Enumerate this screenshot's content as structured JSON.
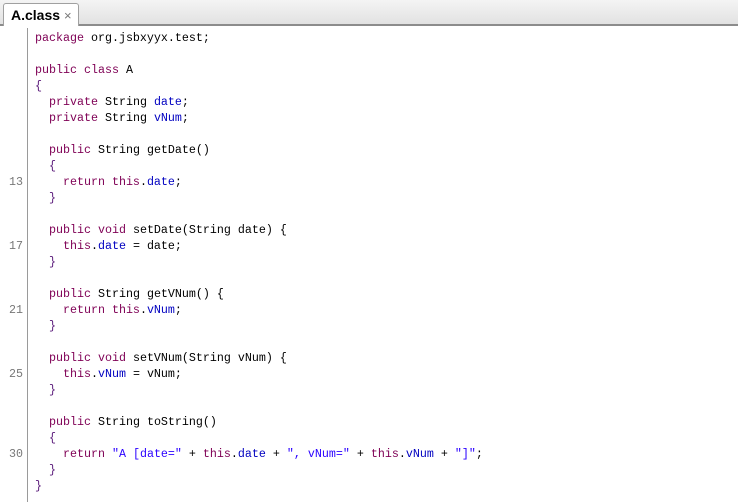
{
  "tab": {
    "title": "A.class",
    "close_icon": "×"
  },
  "colors": {
    "keyword": "#7f0055",
    "field": "#0000c0",
    "string": "#2a00ff"
  },
  "lines": [
    {
      "n": "",
      "t": [
        [
          "kw",
          "package"
        ],
        [
          "txt",
          " org.jsbxyyx.test;"
        ]
      ]
    },
    {
      "n": "",
      "t": []
    },
    {
      "n": "",
      "t": [
        [
          "kw",
          "public class"
        ],
        [
          "txt",
          " A"
        ]
      ]
    },
    {
      "n": "",
      "t": [
        [
          "br",
          "{"
        ]
      ]
    },
    {
      "n": "",
      "t": [
        [
          "txt",
          "  "
        ],
        [
          "kw",
          "private"
        ],
        [
          "txt",
          " String "
        ],
        [
          "fld",
          "date"
        ],
        [
          "txt",
          ";"
        ]
      ]
    },
    {
      "n": "",
      "t": [
        [
          "txt",
          "  "
        ],
        [
          "kw",
          "private"
        ],
        [
          "txt",
          " String "
        ],
        [
          "fld",
          "vNum"
        ],
        [
          "txt",
          ";"
        ]
      ]
    },
    {
      "n": "",
      "t": []
    },
    {
      "n": "",
      "t": [
        [
          "txt",
          "  "
        ],
        [
          "kw",
          "public"
        ],
        [
          "txt",
          " String getDate()"
        ]
      ]
    },
    {
      "n": "",
      "t": [
        [
          "txt",
          "  "
        ],
        [
          "br",
          "{"
        ]
      ]
    },
    {
      "n": "13",
      "t": [
        [
          "txt",
          "    "
        ],
        [
          "kw",
          "return this"
        ],
        [
          "txt",
          "."
        ],
        [
          "fld",
          "date"
        ],
        [
          "txt",
          ";"
        ]
      ]
    },
    {
      "n": "",
      "t": [
        [
          "txt",
          "  "
        ],
        [
          "br",
          "}"
        ]
      ]
    },
    {
      "n": "",
      "t": []
    },
    {
      "n": "",
      "t": [
        [
          "txt",
          "  "
        ],
        [
          "kw",
          "public void"
        ],
        [
          "txt",
          " setDate(String date) {"
        ]
      ]
    },
    {
      "n": "17",
      "t": [
        [
          "txt",
          "    "
        ],
        [
          "kw",
          "this"
        ],
        [
          "txt",
          "."
        ],
        [
          "fld",
          "date"
        ],
        [
          "txt",
          " = date;"
        ]
      ]
    },
    {
      "n": "",
      "t": [
        [
          "txt",
          "  "
        ],
        [
          "br",
          "}"
        ]
      ]
    },
    {
      "n": "",
      "t": []
    },
    {
      "n": "",
      "t": [
        [
          "txt",
          "  "
        ],
        [
          "kw",
          "public"
        ],
        [
          "txt",
          " String getVNum() {"
        ]
      ]
    },
    {
      "n": "21",
      "t": [
        [
          "txt",
          "    "
        ],
        [
          "kw",
          "return this"
        ],
        [
          "txt",
          "."
        ],
        [
          "fld",
          "vNum"
        ],
        [
          "txt",
          ";"
        ]
      ]
    },
    {
      "n": "",
      "t": [
        [
          "txt",
          "  "
        ],
        [
          "br",
          "}"
        ]
      ]
    },
    {
      "n": "",
      "t": []
    },
    {
      "n": "",
      "t": [
        [
          "txt",
          "  "
        ],
        [
          "kw",
          "public void"
        ],
        [
          "txt",
          " setVNum(String vNum) {"
        ]
      ]
    },
    {
      "n": "25",
      "t": [
        [
          "txt",
          "    "
        ],
        [
          "kw",
          "this"
        ],
        [
          "txt",
          "."
        ],
        [
          "fld",
          "vNum"
        ],
        [
          "txt",
          " = vNum;"
        ]
      ]
    },
    {
      "n": "",
      "t": [
        [
          "txt",
          "  "
        ],
        [
          "br",
          "}"
        ]
      ]
    },
    {
      "n": "",
      "t": []
    },
    {
      "n": "",
      "t": [
        [
          "txt",
          "  "
        ],
        [
          "kw",
          "public"
        ],
        [
          "txt",
          " String toString()"
        ]
      ]
    },
    {
      "n": "",
      "t": [
        [
          "txt",
          "  "
        ],
        [
          "br",
          "{"
        ]
      ]
    },
    {
      "n": "30",
      "t": [
        [
          "txt",
          "    "
        ],
        [
          "kw",
          "return"
        ],
        [
          "txt",
          " "
        ],
        [
          "str",
          "\"A [date=\""
        ],
        [
          "txt",
          " + "
        ],
        [
          "kw",
          "this"
        ],
        [
          "txt",
          "."
        ],
        [
          "fld",
          "date"
        ],
        [
          "txt",
          " + "
        ],
        [
          "str",
          "\", vNum=\""
        ],
        [
          "txt",
          " + "
        ],
        [
          "kw",
          "this"
        ],
        [
          "txt",
          "."
        ],
        [
          "fld",
          "vNum"
        ],
        [
          "txt",
          " + "
        ],
        [
          "str",
          "\"]\""
        ],
        [
          "txt",
          ";"
        ]
      ]
    },
    {
      "n": "",
      "t": [
        [
          "txt",
          "  "
        ],
        [
          "br",
          "}"
        ]
      ]
    },
    {
      "n": "",
      "t": [
        [
          "br",
          "}"
        ]
      ]
    }
  ]
}
